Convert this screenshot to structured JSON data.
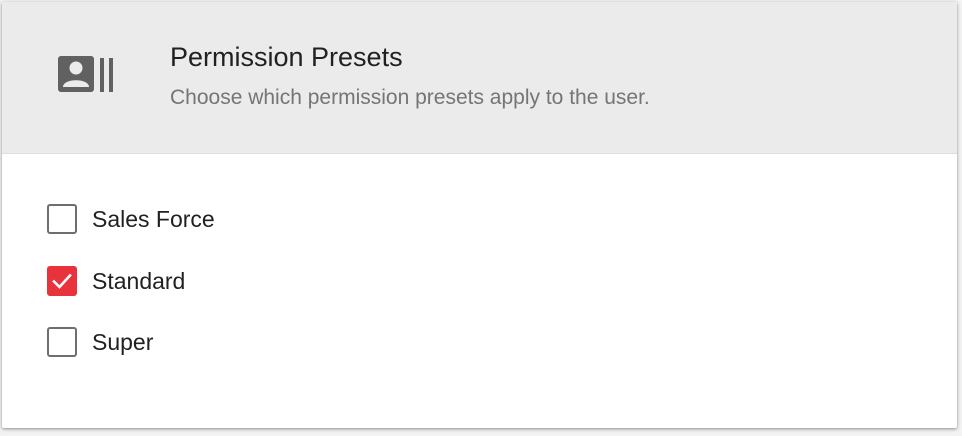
{
  "header": {
    "icon": "contact-card-icon",
    "title": "Permission Presets",
    "subtitle": "Choose which permission presets apply to the user."
  },
  "options": [
    {
      "label": "Sales Force",
      "checked": false
    },
    {
      "label": "Standard",
      "checked": true
    },
    {
      "label": "Super",
      "checked": false
    }
  ],
  "colors": {
    "header_bg": "#ebebeb",
    "checked_accent": "#e8323c",
    "unchecked_border": "#6e6e6e"
  }
}
